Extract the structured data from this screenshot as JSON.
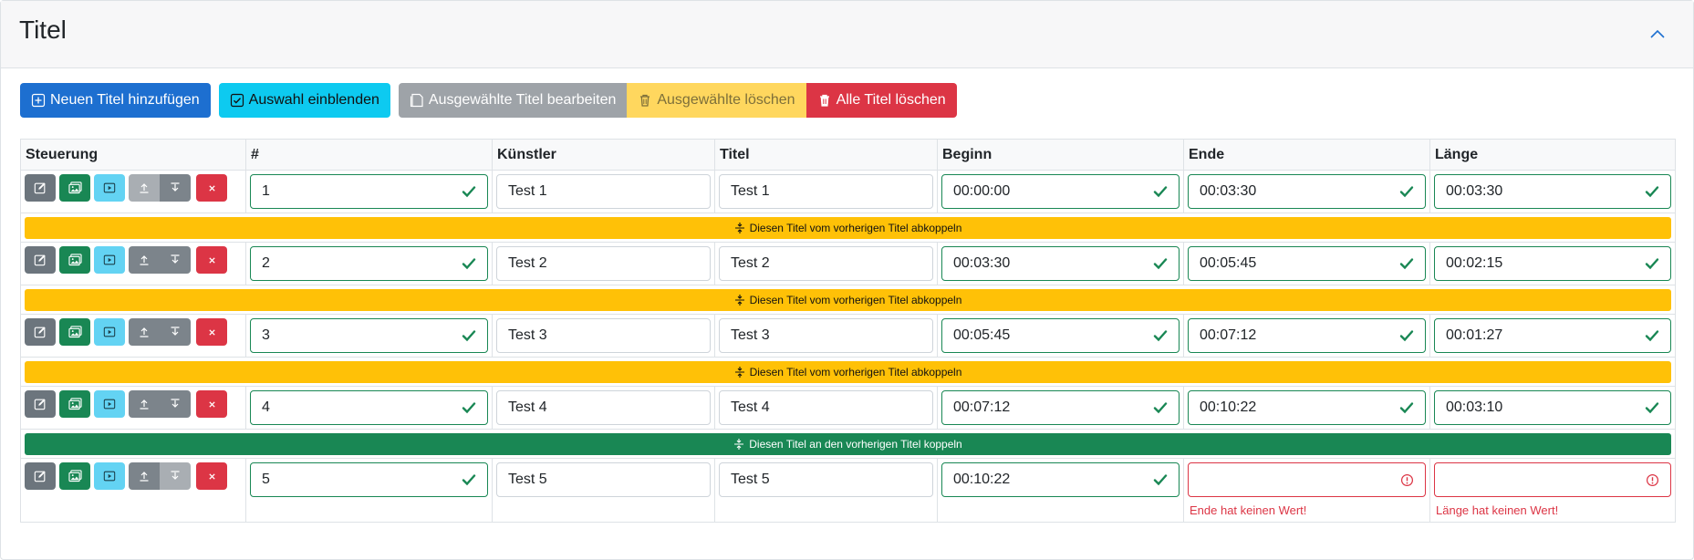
{
  "header": {
    "title": "Titel",
    "collapse_icon": "chevron-up-icon"
  },
  "toolbar": {
    "add_label": "Neuen Titel hinzufügen",
    "show_selection_label": "Auswahl einblenden",
    "edit_selected_label": "Ausgewählte Titel bearbeiten",
    "delete_selected_label": "Ausgewählte löschen",
    "delete_all_label": "Alle Titel löschen"
  },
  "table": {
    "columns": [
      "Steuerung",
      "#",
      "Künstler",
      "Titel",
      "Beginn",
      "Ende",
      "Länge"
    ],
    "rows": [
      {
        "num": "1",
        "artist": "Test 1",
        "title": "Test 1",
        "begin": "00:00:00",
        "end": "00:03:30",
        "length": "00:03:30",
        "first": true,
        "last": false
      },
      {
        "num": "2",
        "artist": "Test 2",
        "title": "Test 2",
        "begin": "00:03:30",
        "end": "00:05:45",
        "length": "00:02:15",
        "first": false,
        "last": false
      },
      {
        "num": "3",
        "artist": "Test 3",
        "title": "Test 3",
        "begin": "00:05:45",
        "end": "00:07:12",
        "length": "00:01:27",
        "first": false,
        "last": false
      },
      {
        "num": "4",
        "artist": "Test 4",
        "title": "Test 4",
        "begin": "00:07:12",
        "end": "00:10:22",
        "length": "00:03:10",
        "first": false,
        "last": false
      },
      {
        "num": "5",
        "artist": "Test 5",
        "title": "Test 5",
        "begin": "00:10:22",
        "end": "",
        "length": "",
        "first": false,
        "last": true,
        "end_error": "Ende hat keinen Wert!",
        "length_error": "Länge hat keinen Wert!"
      }
    ],
    "link_bars": [
      {
        "label": "Diesen Titel vom vorherigen Titel abkoppeln",
        "state": "linked"
      },
      {
        "label": "Diesen Titel vom vorherigen Titel abkoppeln",
        "state": "linked"
      },
      {
        "label": "Diesen Titel vom vorherigen Titel abkoppeln",
        "state": "linked"
      },
      {
        "label": "Diesen Titel an den vorherigen Titel koppeln",
        "state": "unlinked"
      }
    ]
  },
  "colors": {
    "primary": "#1d6fd0",
    "info": "#0dcaf0",
    "secondary": "#9ea3a8",
    "warning": "#ffc107",
    "danger": "#dc3545",
    "success": "#198754"
  }
}
